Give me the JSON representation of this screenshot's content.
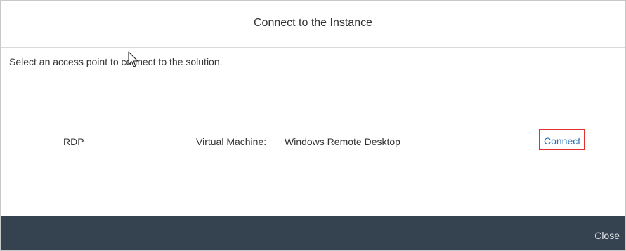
{
  "dialog": {
    "title": "Connect to the Instance",
    "instruction": "Select an access point to connect to the solution."
  },
  "access_points": [
    {
      "type": "RDP",
      "kind": "Virtual Machine:",
      "description": "Windows Remote Desktop",
      "action_label": "Connect"
    }
  ],
  "footer": {
    "close_label": "Close"
  },
  "colors": {
    "footer_bg": "#354351",
    "link": "#2a6fb8",
    "highlight_border": "#e03030"
  },
  "icons": {
    "cursor": "mouse-pointer-icon"
  }
}
